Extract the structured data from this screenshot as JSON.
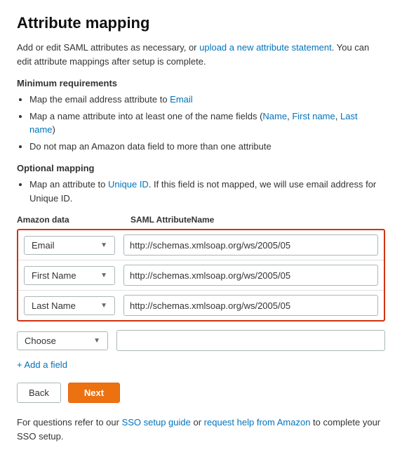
{
  "page": {
    "title": "Attribute mapping",
    "intro": {
      "text_before_link": "Add or edit SAML attributes as necessary, or ",
      "link1_label": "upload a new attribute statement",
      "text_after_link": ". You can edit attribute mappings after setup is complete."
    },
    "min_requirements": {
      "heading": "Minimum requirements",
      "items": [
        {
          "text": "Map the email address attribute to ",
          "link": "Email"
        },
        {
          "text": "Map a name attribute into at least one of the name fields (",
          "links": [
            "Name",
            "First name",
            "Last name"
          ],
          "suffix": ")"
        },
        {
          "text": "Do not map an Amazon data field to more than one attribute"
        }
      ]
    },
    "optional_mapping": {
      "heading": "Optional mapping",
      "items": [
        {
          "text_before": "Map an attribute to Unique ID. If this field is not mapped, we will use email address for Unique ID.",
          "link_text": "Unique ID",
          "link_at": 26
        }
      ]
    },
    "table": {
      "col_amazon": "Amazon data",
      "col_saml": "SAML AttributeName",
      "required_rows": [
        {
          "dropdown_label": "Email",
          "saml_value": "http://schemas.xmlsoap.org/ws/2005/05"
        },
        {
          "dropdown_label": "First Name",
          "saml_value": "http://schemas.xmlsoap.org/ws/2005/05"
        },
        {
          "dropdown_label": "Last Name",
          "saml_value": "http://schemas.xmlsoap.org/ws/2005/05"
        }
      ],
      "optional_row": {
        "dropdown_label": "Choose",
        "saml_value": ""
      }
    },
    "add_field_label": "+ Add a field",
    "buttons": {
      "back": "Back",
      "next": "Next"
    },
    "footer": {
      "text_before": "For questions refer to our ",
      "sso_link": "SSO setup guide",
      "text_middle": " or ",
      "amazon_link": "request help from Amazon",
      "text_after": " to complete your SSO setup."
    }
  }
}
